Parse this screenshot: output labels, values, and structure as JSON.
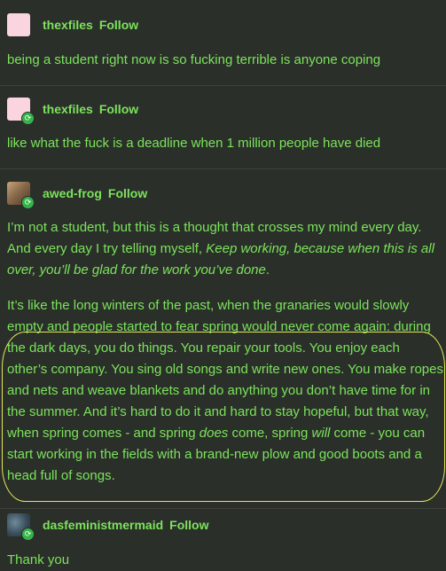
{
  "posts": [
    {
      "username": "thexfiles",
      "follow": "Follow",
      "avatar_color": "#fad4de",
      "text": "being a student right now is so fucking terrible is anyone coping"
    },
    {
      "username": "thexfiles",
      "follow": "Follow",
      "avatar_color": "#fad4de",
      "reblog_icon": "reblog-icon",
      "text": "like what the fuck is a deadline when 1 million people have died"
    },
    {
      "username": "awed-frog",
      "follow": "Follow",
      "reblog_icon": "reblog-icon",
      "p1_a": "I’m not a student, but this is a thought that crosses my mind every day. And every day I try telling myself, ",
      "p1_em": "Keep working, because when this is all over, you’ll be glad for the work you’ve done",
      "p1_end": ".",
      "p2_a": "It’s like the long winters of the past, when the granaries would slowly empty and people started to fear spring would never come again: during the dark days, you do things. You repair your tools. You enjoy each other’s company. You sing old songs and write new ones. You make ropes and nets and weave blankets and do anything you don’t have time for in the summer. And it’s hard to do it and hard to stay hopeful, but that way, when spring comes - and spring ",
      "p2_em1": "does",
      "p2_b": " come, spring ",
      "p2_em2": "will",
      "p2_c": " come - you can start working in the fields with a brand-new plow and good boots and a head full of songs."
    },
    {
      "username": "dasfeministmermaid",
      "follow": "Follow",
      "reblog_icon": "reblog-icon",
      "text": "Thank you"
    }
  ],
  "colors": {
    "background": "#2b2f2a",
    "text": "#7be35b",
    "highlight": "#e7e85a",
    "divider": "#3d423c"
  }
}
